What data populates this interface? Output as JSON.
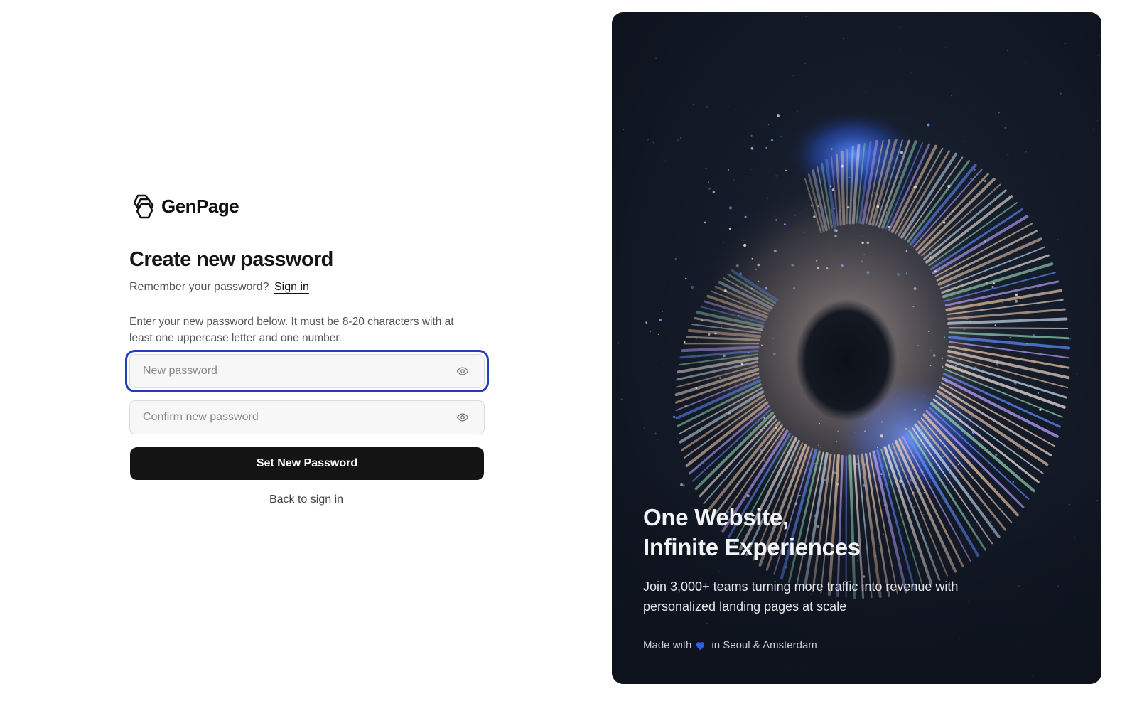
{
  "brand": {
    "name": "GenPage",
    "logo_icon": "hexagon-rings-logo"
  },
  "form": {
    "title": "Create new password",
    "remember_text": "Remember your password?",
    "sign_in_link": "Sign in",
    "help_text": "Enter your new password below. It must be 8-20 characters with at least one uppercase letter and one number.",
    "new_password": {
      "placeholder": "New password",
      "value": "",
      "toggle_icon": "eye-icon",
      "focused": true
    },
    "confirm_password": {
      "placeholder": "Confirm new password",
      "value": "",
      "toggle_icon": "eye-icon"
    },
    "submit_label": "Set New Password",
    "back_link": "Back to sign in"
  },
  "hero": {
    "title_line1": "One Website,",
    "title_line2": "Infinite Experiences",
    "subtitle": "Join 3,000+ teams turning more traffic into revenue with personalized landing pages at scale",
    "footer_prefix": "Made with",
    "footer_icon": "blue-heart-icon",
    "footer_suffix": "in Seoul & Amsterdam"
  },
  "colors": {
    "focus_ring": "#1f3fbf",
    "button_bg": "#141414",
    "hero_bg": "#141b28",
    "accent_blue": "#2f6bff",
    "heart": "#2f5fe0"
  }
}
